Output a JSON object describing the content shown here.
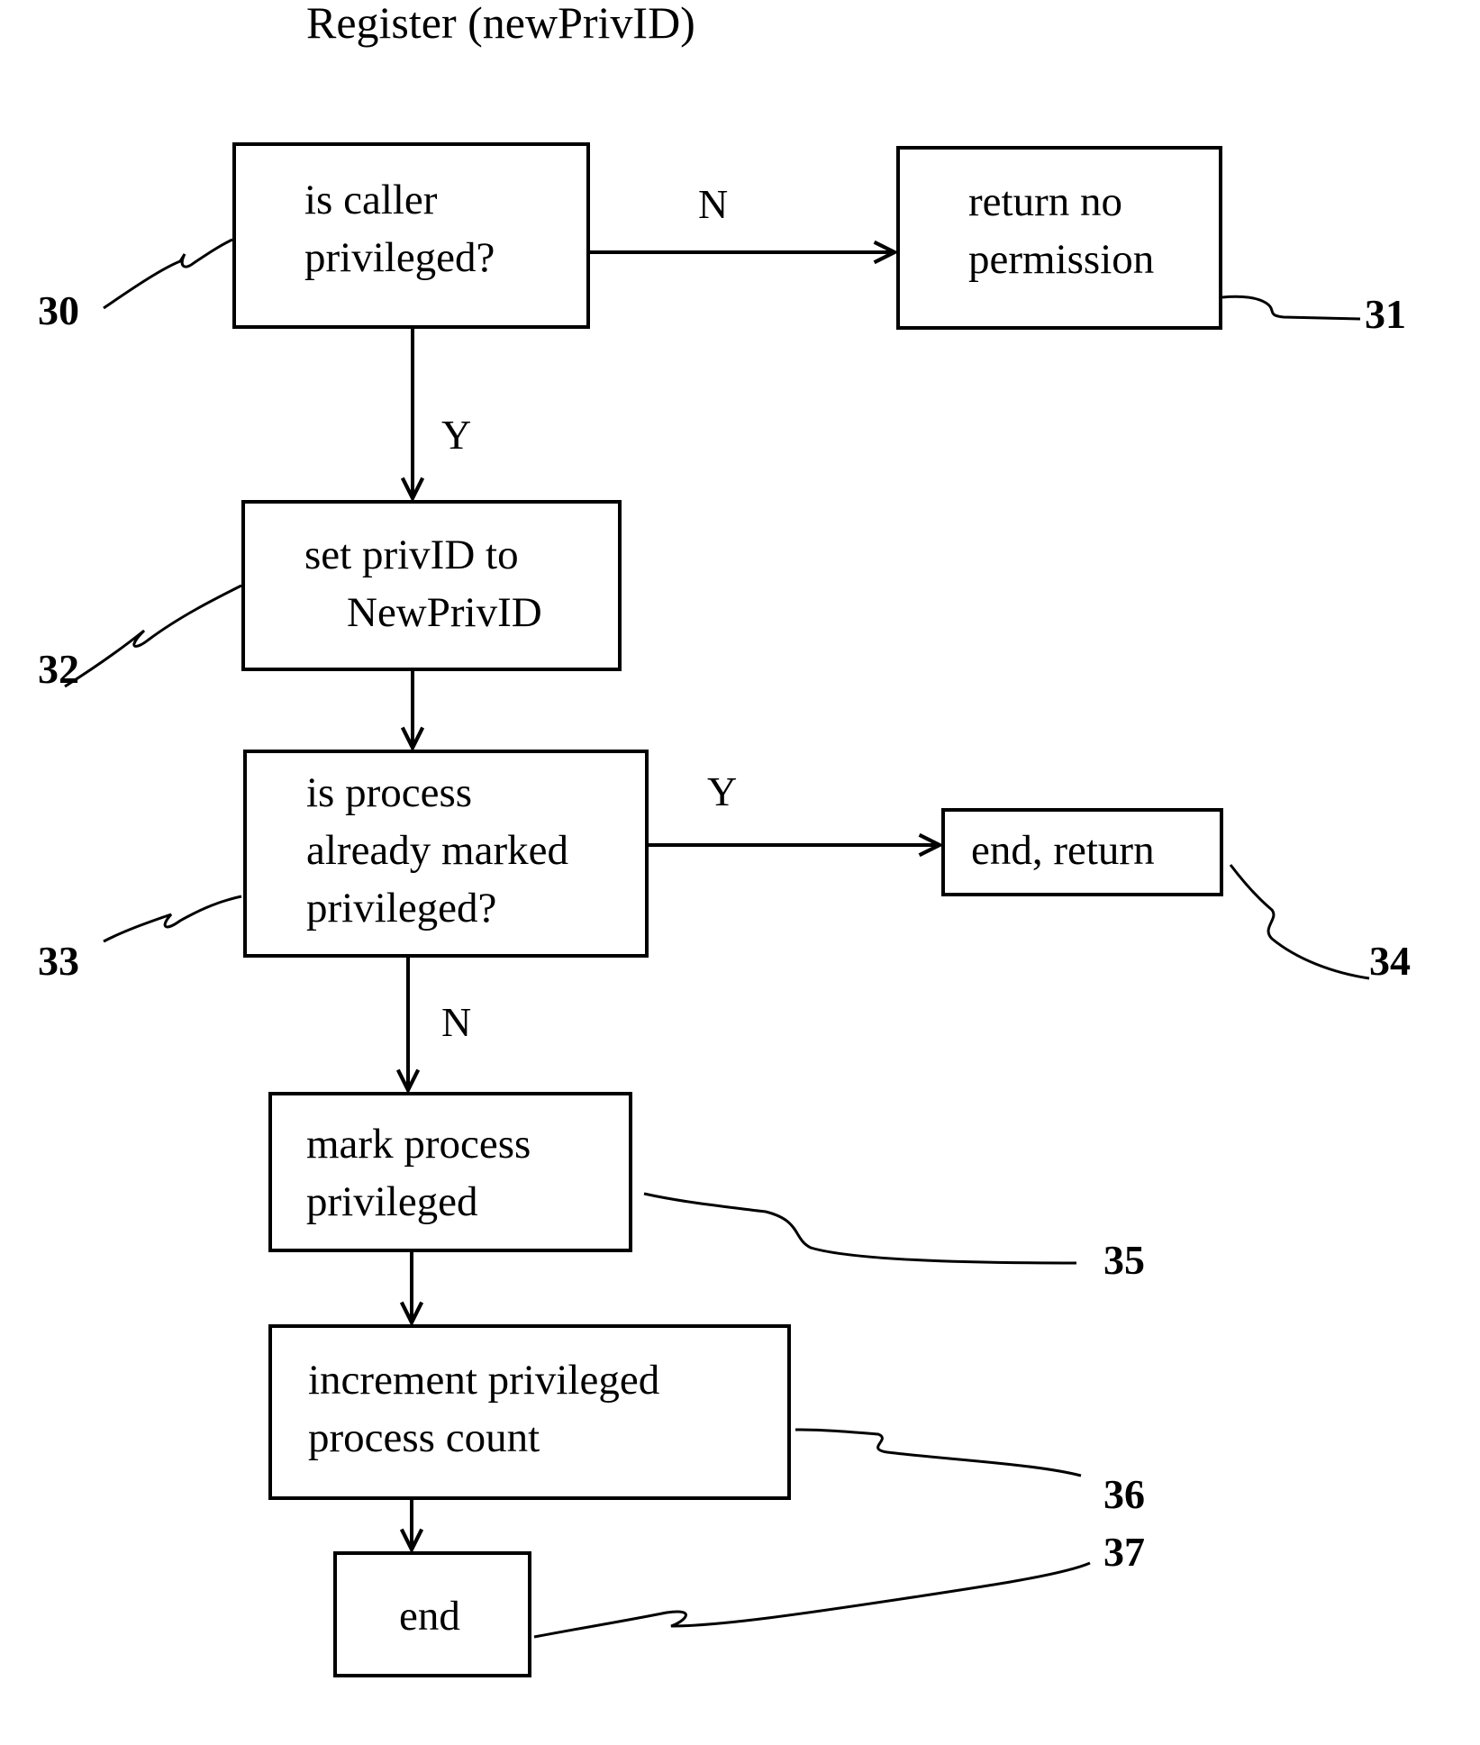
{
  "title": "Register (newPrivID)",
  "nodes": [
    {
      "id": "30",
      "ref": "30",
      "lines": [
        "is caller",
        "privileged?"
      ],
      "type": "decision"
    },
    {
      "id": "31",
      "ref": "31",
      "lines": [
        "return no",
        "permission"
      ],
      "type": "process"
    },
    {
      "id": "32",
      "ref": "32",
      "lines": [
        "set privID to",
        "    NewPrivID"
      ],
      "type": "process"
    },
    {
      "id": "33",
      "ref": "33",
      "lines": [
        "is process",
        "already marked",
        "privileged?"
      ],
      "type": "decision"
    },
    {
      "id": "34",
      "ref": "34",
      "lines": [
        "end, return"
      ],
      "type": "terminal"
    },
    {
      "id": "35",
      "ref": "35",
      "lines": [
        "mark process",
        "privileged"
      ],
      "type": "process"
    },
    {
      "id": "36",
      "ref": "36",
      "lines": [
        "increment privileged",
        "process count"
      ],
      "type": "process"
    },
    {
      "id": "37",
      "ref": "37",
      "lines": [
        "end"
      ],
      "type": "terminal"
    }
  ],
  "edges": [
    {
      "from": "30",
      "to": "31",
      "label": "N"
    },
    {
      "from": "30",
      "to": "32",
      "label": "Y"
    },
    {
      "from": "32",
      "to": "33",
      "label": ""
    },
    {
      "from": "33",
      "to": "34",
      "label": "Y"
    },
    {
      "from": "33",
      "to": "35",
      "label": "N"
    },
    {
      "from": "35",
      "to": "36",
      "label": ""
    },
    {
      "from": "36",
      "to": "37",
      "label": ""
    }
  ]
}
